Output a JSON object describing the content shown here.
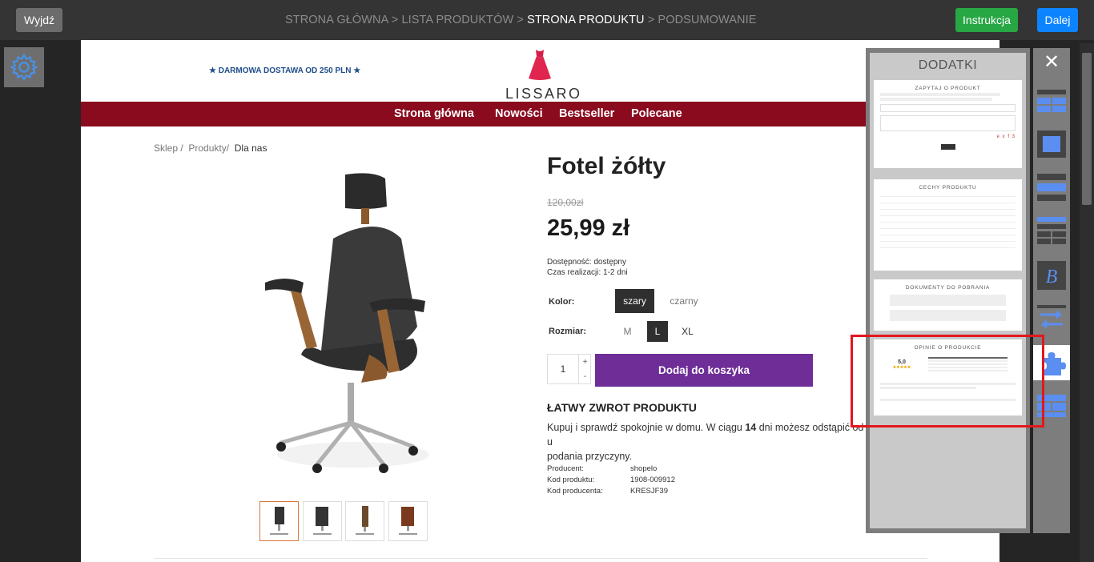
{
  "topbar": {
    "exit": "Wyjdź",
    "breadcrumb": [
      "STRONA GŁÓWNA",
      " > ",
      "LISTA PRODUKTÓW",
      " > ",
      "STRONA PRODUKTU",
      " > ",
      "PODSUMOWANIE"
    ],
    "instruction": "Instrukcja",
    "next": "Dalej"
  },
  "store": {
    "promo": "★ DARMOWA DOSTAWA OD 250 PLN ★",
    "logo": "LISSARO",
    "nav": [
      "Strona główna",
      "Nowości",
      "Bestseller",
      "Polecane"
    ],
    "breadcrumb": [
      "Sklep",
      "Produkty",
      "Dla nas"
    ]
  },
  "product": {
    "title": "Fotel żółty",
    "old_price": "120,00zł",
    "price": "25,99 zł",
    "availability": "Dostępność: dostępny",
    "lead_time": "Czas realizacji: 1-2 dni",
    "color_label": "Kolor:",
    "colors": [
      "szary",
      "czarny"
    ],
    "size_label": "Rozmiar:",
    "sizes": [
      "M",
      "L",
      "XL"
    ],
    "qty": "1",
    "plus": "+",
    "minus": "-",
    "add_to_cart": "Dodaj do koszyka",
    "return_title": "ŁATWY ZWROT PRODUKTU",
    "return_text_1": "Kupuj i sprawdź spokojnie w domu. W ciągu ",
    "return_days": "14",
    "return_text_2": " dni możesz odstąpić od u",
    "return_text_3": "podania przyczyny.",
    "specs": [
      {
        "k": "Producent:",
        "v": "shopelo"
      },
      {
        "k": "Kod produktu:",
        "v": "1908-009912"
      },
      {
        "k": "Kod producenta:",
        "v": "KRESJF39"
      }
    ]
  },
  "addons": {
    "title": "DODATKI",
    "cards": [
      {
        "title": "ZAPYTAJ O PRODUKT",
        "captcha": "e x f 3"
      },
      {
        "title": "CECHY PRODUKTU"
      },
      {
        "title": "DOKUMENTY DO POBRANIA"
      },
      {
        "title": "OPINIE O PRODUKCIE",
        "rating": "5,0",
        "stars": "★★★★★"
      }
    ],
    "close": "✕"
  },
  "colors": {
    "nav": "#8a0b1e",
    "cart": "#6e2d97",
    "instr": "#28a745",
    "next": "#0d84ff",
    "highlight": "#e3171d"
  }
}
